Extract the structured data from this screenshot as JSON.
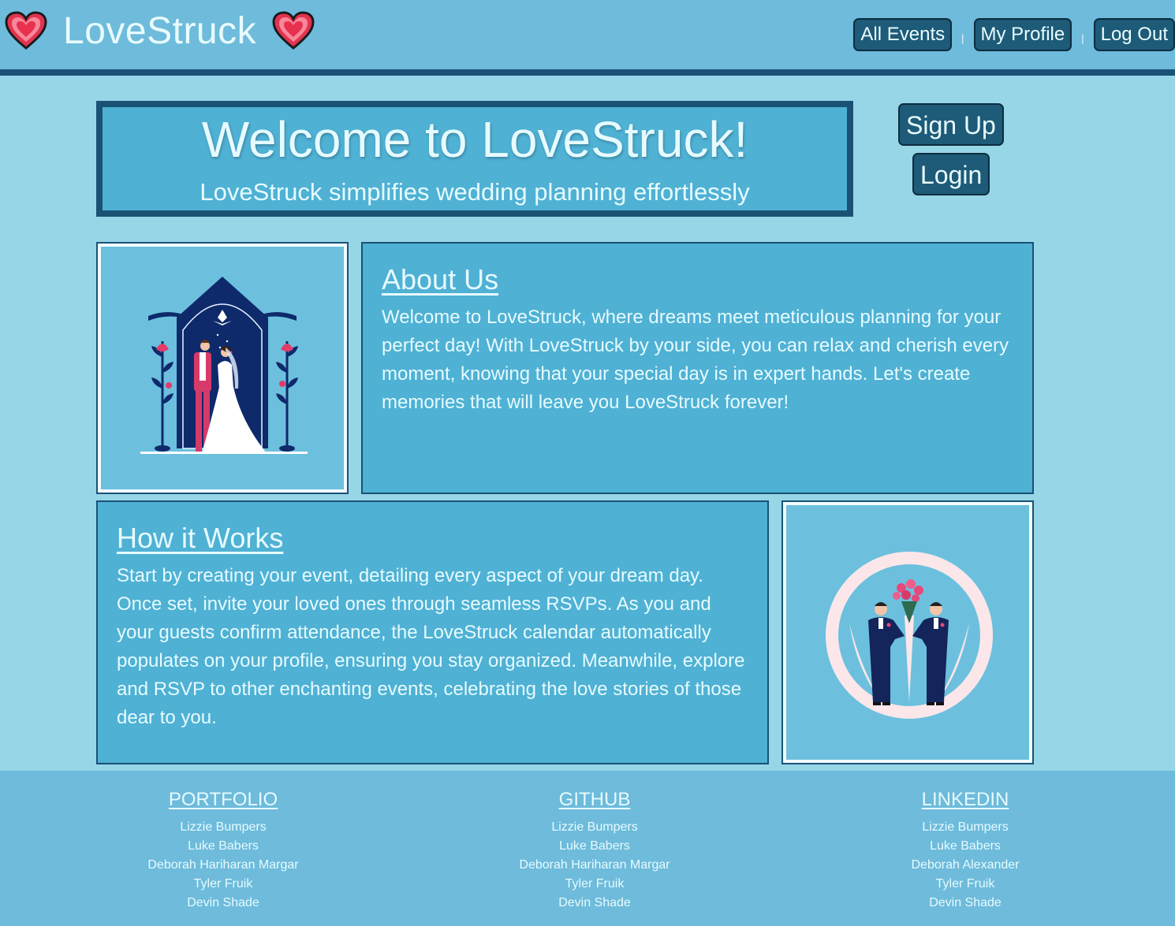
{
  "header": {
    "brand": "LoveStruck",
    "nav": [
      {
        "label": "All Events"
      },
      {
        "label": "My Profile"
      },
      {
        "label": "Log Out"
      }
    ],
    "separator": "|"
  },
  "welcome": {
    "title": "Welcome to LoveStruck!",
    "subtitle": "LoveStruck simplifies wedding planning effortlessly"
  },
  "auth": {
    "signup_label": "Sign Up",
    "login_label": "Login"
  },
  "about": {
    "heading": "About Us",
    "body": "Welcome to LoveStruck, where dreams meet meticulous planning for your perfect day! With LoveStruck by your side, you can relax and cherish every moment, knowing that your special day is in expert hands. Let's create memories that will leave you LoveStruck forever!"
  },
  "how": {
    "heading": "How it Works",
    "body": "Start by creating your event, detailing every aspect of your dream day. Once set, invite your loved ones through seamless RSVPs. As you and your guests confirm attendance, the LoveStruck calendar automatically populates on your profile, ensuring you stay organized. Meanwhile, explore and RSVP to other enchanting events, celebrating the love stories of those dear to you."
  },
  "footer": {
    "portfolio": {
      "heading": "PORTFOLIO",
      "items": [
        "Lizzie Bumpers",
        "Luke Babers",
        "Deborah Hariharan Margar",
        "Tyler Fruik",
        "Devin Shade"
      ]
    },
    "github": {
      "heading": "GITHUB",
      "items": [
        "Lizzie Bumpers",
        "Luke Babers",
        "Deborah Hariharan Margar",
        "Tyler Fruik",
        "Devin Shade"
      ]
    },
    "linkedin": {
      "heading": "LINKEDIN",
      "items": [
        "Lizzie Bumpers",
        "Luke Babers",
        "Deborah Alexander",
        "Tyler Fruik",
        "Devin Shade"
      ]
    }
  },
  "icons": {
    "brand_left": "heart-icon",
    "brand_right": "heart-icon"
  },
  "colors": {
    "page_bg": "#96d6e7",
    "header_bg": "#6ebbdb",
    "panel_bg": "#4fb1d4",
    "border": "#1a5276",
    "button_bg": "#1d5b78",
    "text": "#e6fbff"
  }
}
